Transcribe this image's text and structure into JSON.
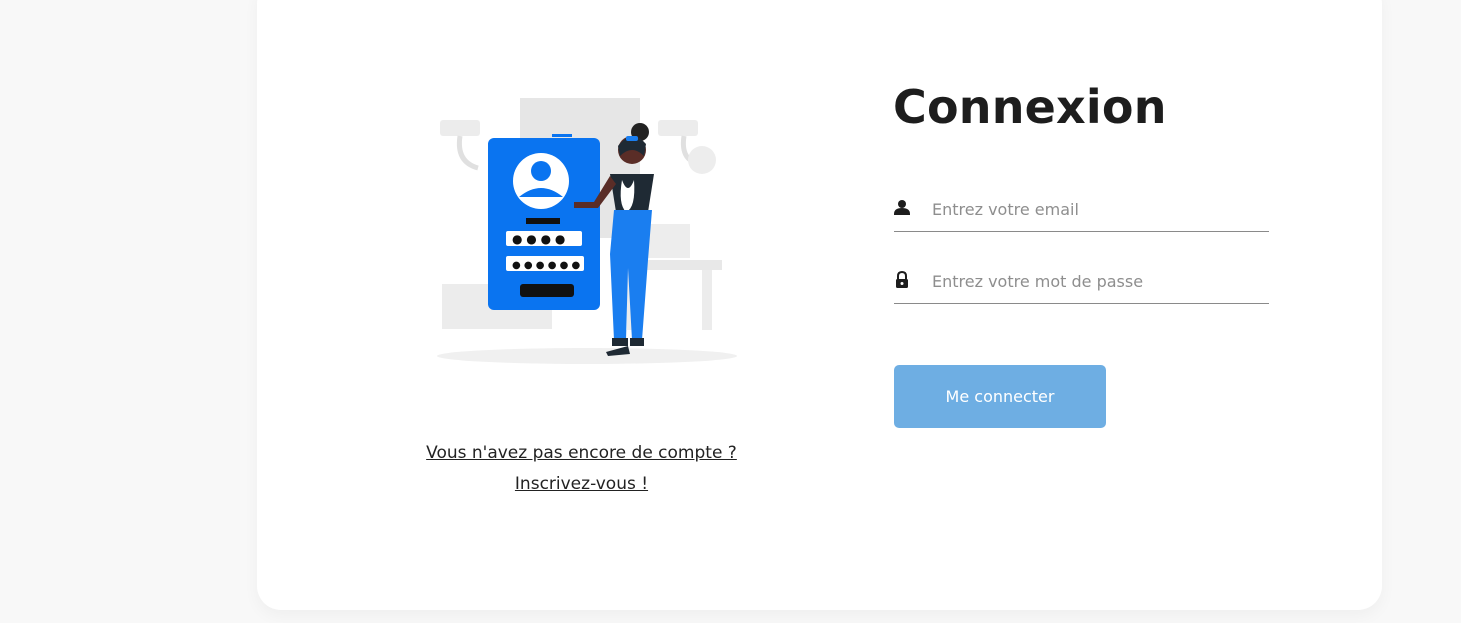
{
  "login": {
    "title": "Connexion",
    "email_placeholder": "Entrez votre email",
    "password_placeholder": "Entrez votre mot de passe",
    "submit_label": "Me connecter"
  },
  "signup": {
    "prompt": "Vous n'avez pas encore de compte ?",
    "link_label": "Inscrivez-vous !"
  },
  "illustration": {
    "name": "login-illustration",
    "icons": [
      "user-icon",
      "lock-icon"
    ]
  },
  "colors": {
    "accent_blue": "#0a74f0",
    "button": "#6eaee3",
    "title": "#1d1d1d",
    "page_bg": "#f8f8f8"
  }
}
